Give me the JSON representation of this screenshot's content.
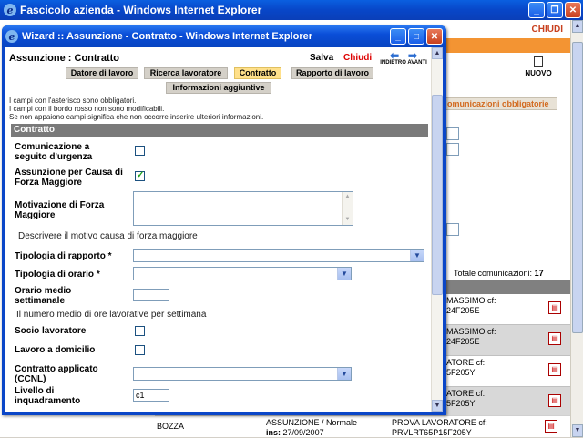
{
  "background_window": {
    "title": "Fascicolo azienda - Windows Internet Explorer",
    "chiudi_label": "CHIUDI",
    "nuovo_label": "NUOVO",
    "comm_tab_label": "omunicazioni obbligatorie",
    "total_label": "Totale comunicazioni:",
    "total_value": "17",
    "rows": [
      {
        "line1": "MASSIMO cf:",
        "line2": "24F205E"
      },
      {
        "line1": "MASSIMO cf:",
        "line2": "24F205E"
      },
      {
        "line1": "ATORE cf:",
        "line2": "5F205Y"
      },
      {
        "line1": "ATORE cf:",
        "line2": "5F205Y"
      },
      {
        "line1": "ATORE cf:",
        "line2": "5F205Y"
      }
    ],
    "bottom_row": {
      "status": "BOZZA",
      "type_line1": "ASSUNZIONE / Normale",
      "type_line2_label": "ins:",
      "type_line2_value": "27/09/2007",
      "person_line1": "PROVA LAVORATORE cf:",
      "person_line2": "PRVLRT65P15F205Y"
    }
  },
  "wizard": {
    "title": "Wizard :: Assunzione - Contratto - Windows Internet Explorer",
    "header": "Assunzione : Contratto",
    "salva_label": "Salva",
    "chiudi_label": "Chiudi",
    "nav_label": "INDIETRO AVANTI",
    "tabs": [
      {
        "label": "Datore di lavoro",
        "active": false
      },
      {
        "label": "Ricerca lavoratore",
        "active": false
      },
      {
        "label": "Contratto",
        "active": true
      },
      {
        "label": "Rapporto di lavoro",
        "active": false
      },
      {
        "label": "Informazioni aggiuntive",
        "active": false
      }
    ],
    "notes": [
      "I campi con l'asterisco sono obbligatori.",
      "I campi con il bordo rosso non sono modificabili.",
      "Se non appaiono campi significa che non occorre inserire ulteriori informazioni."
    ],
    "section_title": "Contratto",
    "fields": {
      "urgenza_label": "Comunicazione a seguito d'urgenza",
      "urgenza_checked": false,
      "forza_maggiore_label": "Assunzione per Causa di Forza Maggiore",
      "forza_maggiore_checked": true,
      "motivazione_label": "Motivazione di Forza Maggiore",
      "motivazione_value": "",
      "motivazione_hint": "Descrivere il motivo causa di forza maggiore",
      "tipologia_rapporto_label": "Tipologia di rapporto *",
      "tipologia_rapporto_value": "",
      "tipologia_orario_label": "Tipologia di orario *",
      "tipologia_orario_value": "",
      "orario_medio_label": "Orario medio settimanale",
      "orario_medio_value": "",
      "orario_medio_hint": "Il numero medio di ore lavorative per settimana",
      "socio_label": "Socio lavoratore",
      "socio_checked": false,
      "domicilio_label": "Lavoro a domicilio",
      "domicilio_checked": false,
      "ccnl_label": "Contratto applicato (CCNL)",
      "ccnl_value": "",
      "livello_label": "Livello di inquadramento",
      "livello_value": "c1"
    }
  }
}
